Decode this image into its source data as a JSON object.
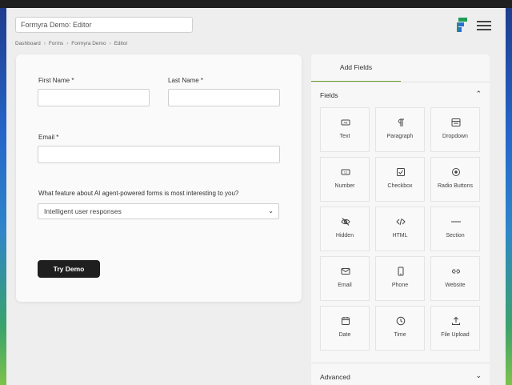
{
  "header": {
    "title_value": "Formyra Demo: Editor"
  },
  "breadcrumb": [
    "Dashboard",
    "Forms",
    "Formyra Demo",
    "Editor"
  ],
  "form": {
    "first_name_label": "First Name *",
    "last_name_label": "Last Name *",
    "email_label": "Email *",
    "question_label": "What feature about AI agent-powered forms is most interesting to you?",
    "select_value": "Intelligent user responses",
    "submit_label": "Try Demo"
  },
  "panel": {
    "tab_label": "Add Fields",
    "fields_section": "Fields",
    "advanced_section": "Advanced",
    "accent": "#6b9e2e",
    "tiles": [
      {
        "label": "Text",
        "icon": "text-field-icon"
      },
      {
        "label": "Paragraph",
        "icon": "paragraph-icon"
      },
      {
        "label": "Dropdown",
        "icon": "dropdown-icon"
      },
      {
        "label": "Number",
        "icon": "number-icon"
      },
      {
        "label": "Checkbox",
        "icon": "checkbox-icon"
      },
      {
        "label": "Radio Buttons",
        "icon": "radio-icon"
      },
      {
        "label": "Hidden",
        "icon": "hidden-eye-icon"
      },
      {
        "label": "HTML",
        "icon": "code-icon"
      },
      {
        "label": "Section",
        "icon": "section-divider-icon"
      },
      {
        "label": "Email",
        "icon": "email-icon"
      },
      {
        "label": "Phone",
        "icon": "phone-icon"
      },
      {
        "label": "Website",
        "icon": "link-icon"
      },
      {
        "label": "Date",
        "icon": "calendar-icon"
      },
      {
        "label": "Time",
        "icon": "clock-icon"
      },
      {
        "label": "File Upload",
        "icon": "upload-icon"
      }
    ]
  }
}
